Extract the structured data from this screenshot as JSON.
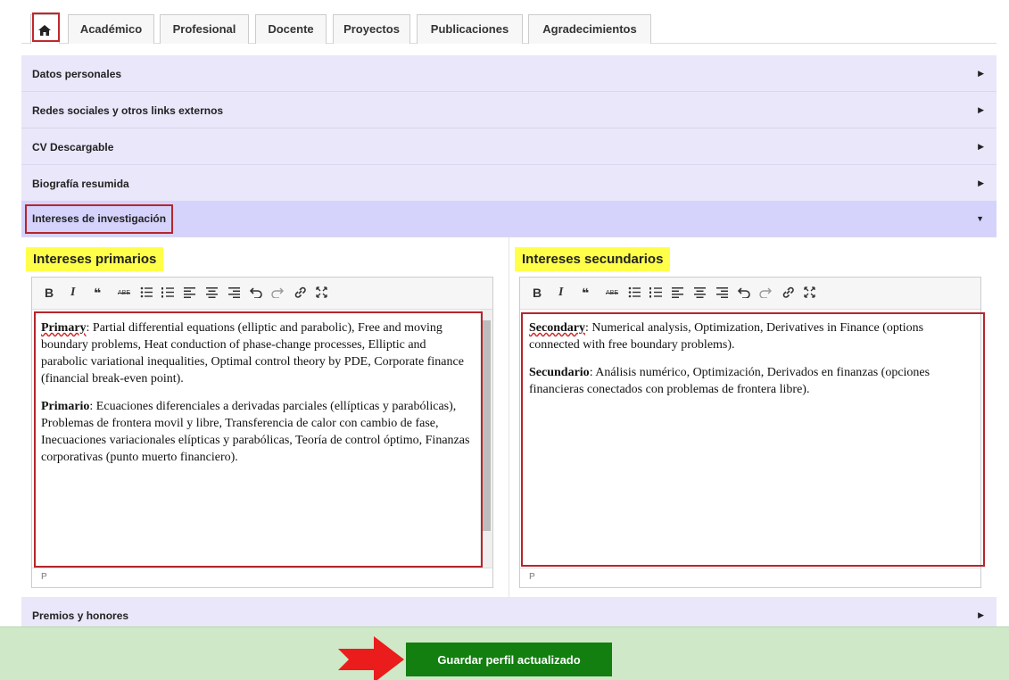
{
  "tabs": [
    {
      "label": "Académico"
    },
    {
      "label": "Profesional"
    },
    {
      "label": "Docente"
    },
    {
      "label": "Proyectos"
    },
    {
      "label": "Publicaciones"
    },
    {
      "label": "Agradecimientos"
    }
  ],
  "accordion": [
    {
      "label": "Datos personales"
    },
    {
      "label": "Redes sociales y otros links externos"
    },
    {
      "label": "CV Descargable"
    },
    {
      "label": "Biografía resumida"
    },
    {
      "label": "Intereses de investigación"
    }
  ],
  "primary": {
    "title": "Intereses primarios",
    "p1_label": "Primary",
    "p1_text": ": Partial differential equations (elliptic and parabolic), Free and moving boundary problems, Heat conduction of phase-change processes, Elliptic and parabolic variational inequalities, Optimal control theory by PDE, Corporate finance (financial break-even point).",
    "p2_label": "Primario",
    "p2_text": ": Ecuaciones diferenciales a derivadas parciales (ellípticas y parabólicas), Problemas de frontera movil y libre, Transferencia de calor con cambio de fase, Inecuaciones variacionales elípticas y parabólicas, Teoría de control óptimo, Finanzas corporativas (punto muerto financiero).",
    "status": "P"
  },
  "secondary": {
    "title": "Intereses secundarios",
    "p1_label": "Secondary",
    "p1_text": ": Numerical analysis, Optimization, Derivatives in Finance (options connected with free boundary problems).",
    "p2_label": "Secundario",
    "p2_text": ": Análisis numérico, Optimización, Derivados en finanzas (opciones financieras conectados con problemas de frontera libre).",
    "status": "P"
  },
  "toolbar_glyphs": {
    "bold": "B",
    "italic": "I",
    "quote": "❝",
    "strikethrough": "ABE"
  },
  "bottom_section": {
    "label": "Premios y honores"
  },
  "save_button": {
    "label": "Guardar perfil actualizado"
  },
  "colors": {
    "accent_green": "#127f10",
    "highlight": "#ffff49",
    "annotation_red": "#b5262c"
  }
}
